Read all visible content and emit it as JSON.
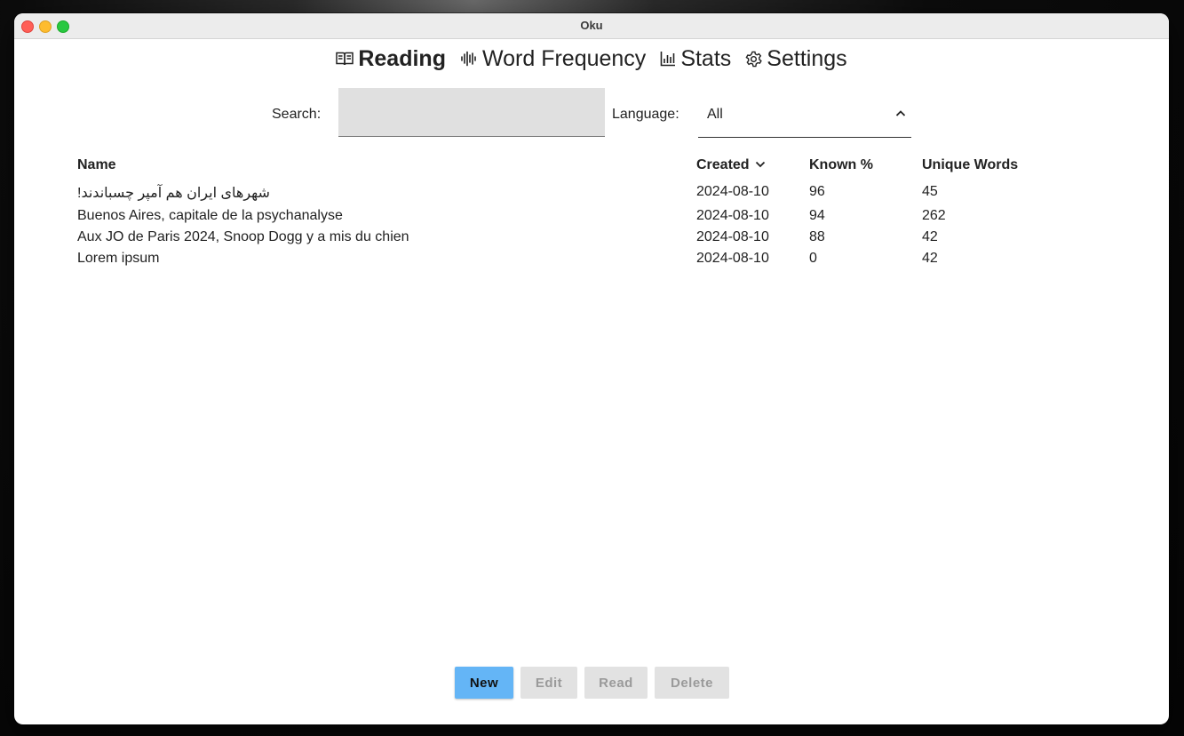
{
  "window": {
    "title": "Oku"
  },
  "tabs": [
    {
      "label": "Reading",
      "icon": "book-open-icon",
      "active": true
    },
    {
      "label": "Word Frequency",
      "icon": "audio-waveform-icon",
      "active": false
    },
    {
      "label": "Stats",
      "icon": "bar-chart-icon",
      "active": false
    },
    {
      "label": "Settings",
      "icon": "gear-icon",
      "active": false
    }
  ],
  "filters": {
    "search_label": "Search:",
    "search_value": "",
    "language_label": "Language:",
    "language_value": "All"
  },
  "table": {
    "columns": {
      "name": "Name",
      "created": "Created",
      "known": "Known %",
      "unique": "Unique Words"
    },
    "sort": {
      "column": "created",
      "direction": "descending"
    },
    "rows": [
      {
        "name": "شهرهای ایران هم آمپر چسباندند!",
        "created": "2024-08-10",
        "known": "96",
        "unique": "45"
      },
      {
        "name": "Buenos Aires, capitale de la psychanalyse",
        "created": "2024-08-10",
        "known": "94",
        "unique": "262"
      },
      {
        "name": "Aux JO de Paris 2024, Snoop Dogg y a mis du chien",
        "created": "2024-08-10",
        "known": "88",
        "unique": "42"
      },
      {
        "name": "Lorem ipsum",
        "created": "2024-08-10",
        "known": "0",
        "unique": "42"
      }
    ]
  },
  "actions": {
    "new": "New",
    "edit": "Edit",
    "read": "Read",
    "delete": "Delete"
  },
  "colors": {
    "primary_button": "#64b5f6",
    "disabled_button": "#e2e2e2",
    "search_background": "#e0e0e0"
  }
}
